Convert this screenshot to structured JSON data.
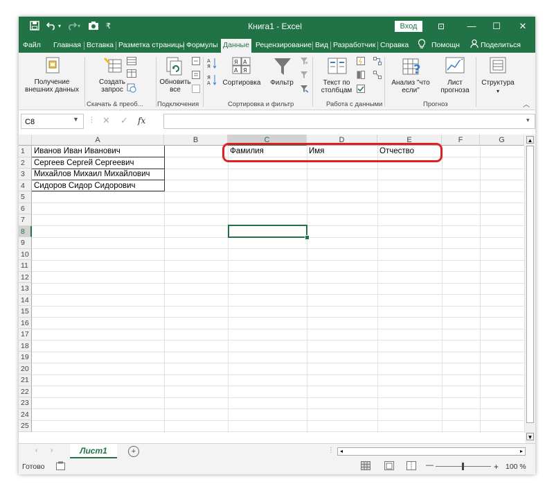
{
  "titlebar": {
    "title": "Книга1 - Excel",
    "signin_label": "Вход",
    "undo_icon": "undo-icon",
    "redo_icon": "redo-icon",
    "minimize": "—",
    "maximize": "☐",
    "close": "✕",
    "ribbon_display": "⊡"
  },
  "tabs": [
    {
      "label": "Файл"
    },
    {
      "label": "Главная"
    },
    {
      "label": "Вставка"
    },
    {
      "label": "Разметка страницы"
    },
    {
      "label": "Формулы"
    },
    {
      "label": "Данные",
      "active": true
    },
    {
      "label": "Рецензирование"
    },
    {
      "label": "Вид"
    },
    {
      "label": "Разработчик"
    },
    {
      "label": "Справка"
    },
    {
      "label": "Помощн"
    },
    {
      "label": "Поделиться"
    }
  ],
  "ribbon": {
    "get_data": "Получение внешних данных",
    "create_query": "Создать запрос",
    "refresh_all": "Обновить все",
    "sort": "Сортировка",
    "filter": "Фильтр",
    "text_to_columns": "Текст по столбцам",
    "what_if": "Анализ \"что если\"",
    "forecast_sheet": "Лист прогноза",
    "outline": "Структура",
    "groups": {
      "get_transform": "Скачать & преоб...",
      "connections": "Подключения",
      "sort_filter": "Сортировка и фильтр",
      "data_tools": "Работа с данными",
      "forecast": "Прогноз"
    }
  },
  "formula_bar": {
    "name_box": "C8",
    "fx": "fx",
    "value": ""
  },
  "columns": [
    "A",
    "B",
    "C",
    "D",
    "E",
    "F",
    "G"
  ],
  "rows": [
    "1",
    "2",
    "3",
    "4",
    "5",
    "6",
    "7",
    "8",
    "9",
    "10",
    "11",
    "12",
    "13",
    "14",
    "15",
    "16",
    "17",
    "18",
    "19",
    "20",
    "21",
    "22",
    "23",
    "24",
    "25"
  ],
  "cells": {
    "A1": "Иванов Иван Иванович",
    "A2": "Сергеев Сергей Сергеевич",
    "A3": "Михайлов Михаил Михайлович",
    "A4": "Сидоров Сидор Сидорович",
    "C1": "Фамилия",
    "D1": "Имя",
    "E1": "Отчество"
  },
  "selected_cell": "C8",
  "sheet_tab": "Лист1",
  "status": {
    "ready": "Готово",
    "zoom": "100 %",
    "zoom_minus": "—",
    "zoom_plus": "+"
  },
  "colors": {
    "accent": "#217346",
    "annotation": "#e02020"
  }
}
